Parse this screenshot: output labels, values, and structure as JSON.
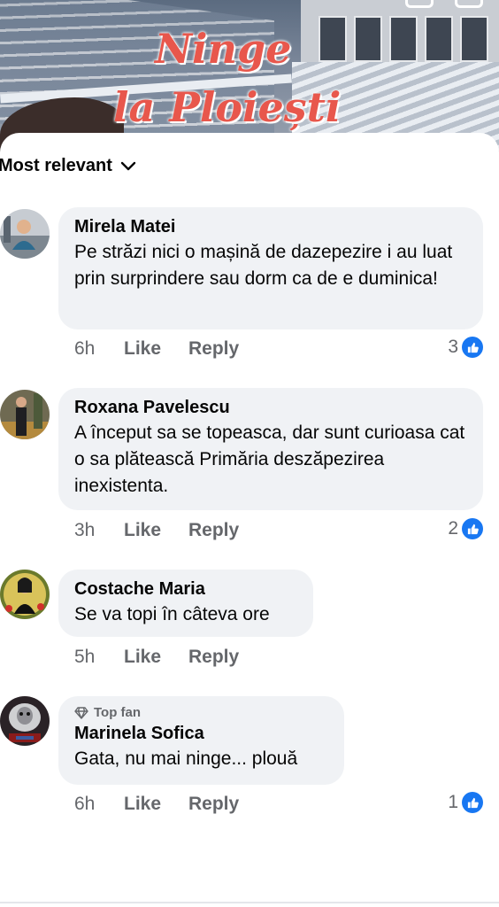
{
  "post_image": {
    "title_line1": "Ninge",
    "title_line2": "la Ploiești"
  },
  "sort": {
    "label": "Most relevant",
    "icon": "chevron-down-icon"
  },
  "comments": [
    {
      "author": "Mirela Matei",
      "text": "Pe străzi nici o mașină de dazepezire i au luat prin surprindere sau dorm ca de e duminica!",
      "time": "6h",
      "like_label": "Like",
      "reply_label": "Reply",
      "reactions": "3"
    },
    {
      "author": "Roxana Pavelescu",
      "text": "A început sa se topeasca, dar sunt curioasa cat o sa plătească Primăria deszăpezirea inexistenta.",
      "time": "3h",
      "like_label": "Like",
      "reply_label": "Reply",
      "reactions": "2"
    },
    {
      "author": "Costache Maria",
      "text": "Se va topi în câteva ore",
      "time": "5h",
      "like_label": "Like",
      "reply_label": "Reply",
      "reactions": ""
    },
    {
      "badge": "Top fan",
      "author": "Marinela Sofica",
      "text": "Gata, nu mai ninge... plouă",
      "time": "6h",
      "like_label": "Like",
      "reply_label": "Reply",
      "reactions": "1"
    }
  ],
  "colors": {
    "bubble": "#f0f2f5",
    "meta_text": "#65676b",
    "like_blue": "#1877f2"
  }
}
